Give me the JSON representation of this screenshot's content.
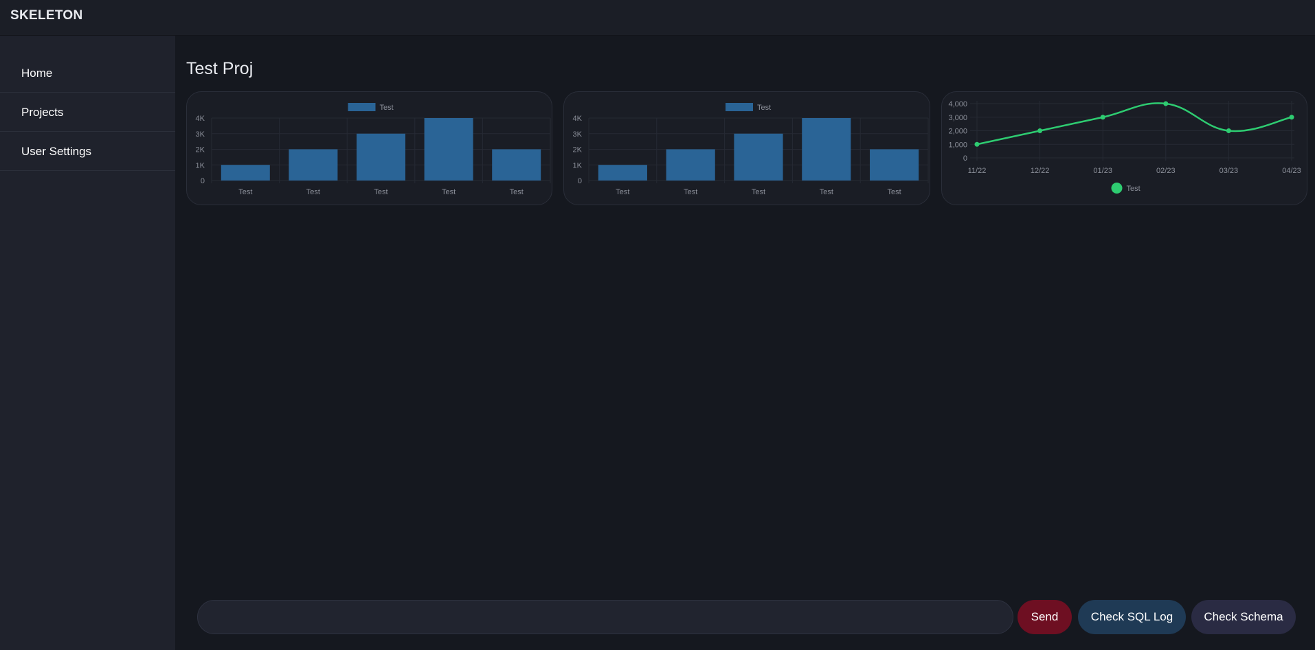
{
  "app": {
    "brand": "SKELETON"
  },
  "sidebar": {
    "items": [
      {
        "label": "Home"
      },
      {
        "label": "Projects"
      },
      {
        "label": "User Settings"
      }
    ]
  },
  "main": {
    "title": "Test Proj"
  },
  "composer": {
    "value": "",
    "placeholder": ""
  },
  "buttons": {
    "send": "Send",
    "check_sql_log": "Check SQL Log",
    "check_schema": "Check Schema"
  },
  "colors": {
    "bar": "#2a6496",
    "line": "#2ecc71",
    "send": "#6e0f22",
    "sql": "#1f3a55",
    "schema": "#2a2b43"
  },
  "chart_data": [
    {
      "type": "bar",
      "categories": [
        "Test",
        "Test",
        "Test",
        "Test",
        "Test"
      ],
      "series": [
        {
          "name": "Test",
          "values": [
            1000,
            2000,
            3000,
            4000,
            2000
          ]
        }
      ],
      "yticks": [
        "0",
        "1K",
        "2K",
        "3K",
        "4K"
      ],
      "ylim": [
        0,
        4000
      ],
      "legend": "top",
      "grid": true
    },
    {
      "type": "bar",
      "categories": [
        "Test",
        "Test",
        "Test",
        "Test",
        "Test"
      ],
      "series": [
        {
          "name": "Test",
          "values": [
            1000,
            2000,
            3000,
            4000,
            2000
          ]
        }
      ],
      "yticks": [
        "0",
        "1K",
        "2K",
        "3K",
        "4K"
      ],
      "ylim": [
        0,
        4000
      ],
      "legend": "top",
      "grid": true
    },
    {
      "type": "line",
      "categories": [
        "11/22",
        "12/22",
        "01/23",
        "02/23",
        "03/23",
        "04/23"
      ],
      "series": [
        {
          "name": "Test",
          "values": [
            1000,
            2000,
            3000,
            4000,
            2000,
            3000
          ]
        }
      ],
      "yticks": [
        "0",
        "1,000",
        "2,000",
        "3,000",
        "4,000"
      ],
      "ylim": [
        0,
        4000
      ],
      "legend": "bottom",
      "grid": true
    }
  ]
}
